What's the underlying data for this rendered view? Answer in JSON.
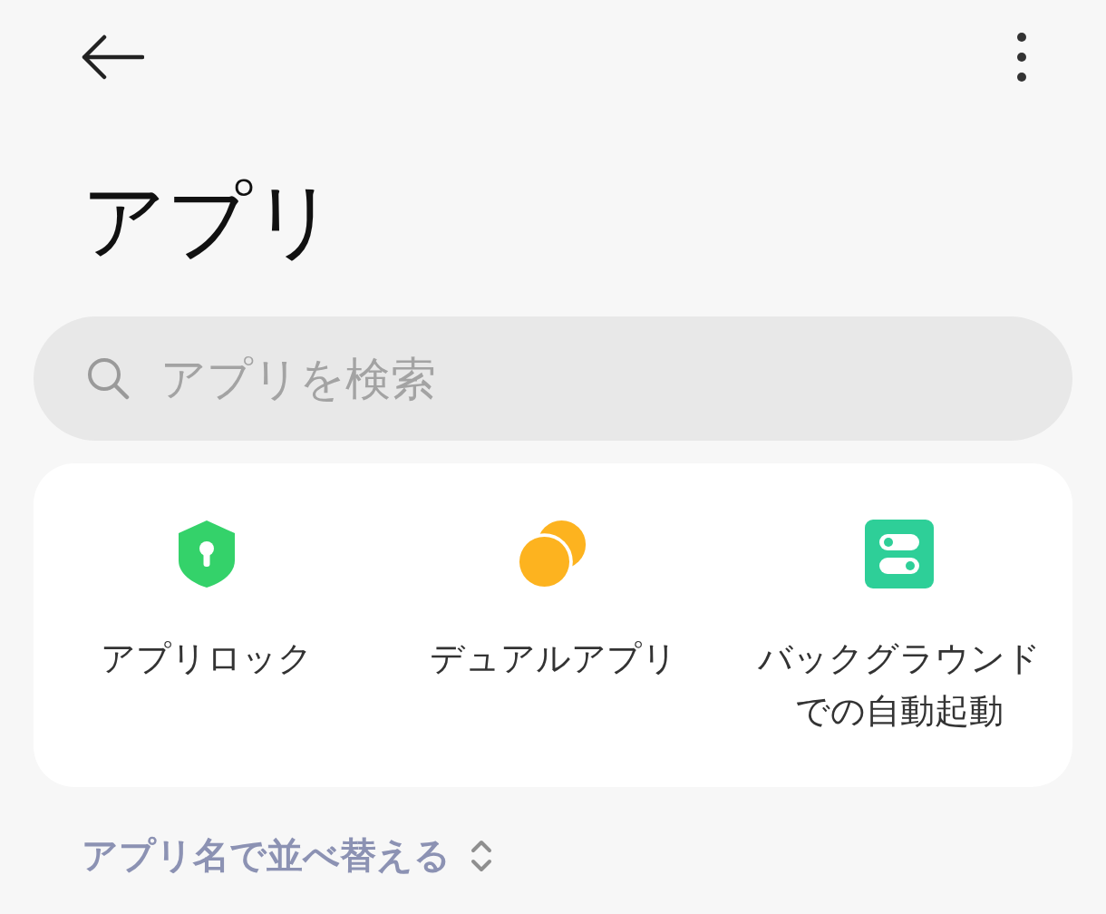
{
  "title": "アプリ",
  "search": {
    "placeholder": "アプリを検索"
  },
  "shortcuts": [
    {
      "kind": "lock",
      "label": "アプリロック"
    },
    {
      "kind": "dual",
      "label": "デュアルアプリ"
    },
    {
      "kind": "toggles",
      "label": "バックグラウンドでの自動起動"
    }
  ],
  "sort": {
    "label": "アプリ名で並べ替える"
  }
}
